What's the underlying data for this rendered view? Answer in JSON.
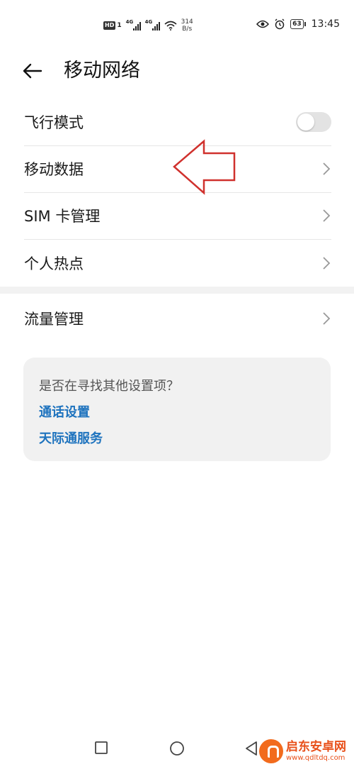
{
  "status_bar": {
    "hd_badge": "HD",
    "sim_index": "1",
    "signal1_label": "4G",
    "signal2_label": "4G",
    "speed_value": "314",
    "speed_unit": "B/s",
    "battery": "63",
    "time": "13:45"
  },
  "header": {
    "title": "移动网络"
  },
  "settings": {
    "airplane_mode": {
      "label": "飞行模式",
      "enabled": false
    },
    "mobile_data": {
      "label": "移动数据"
    },
    "sim_management": {
      "label": "SIM 卡管理"
    },
    "hotspot": {
      "label": "个人热点"
    },
    "data_usage": {
      "label": "流量管理"
    }
  },
  "suggestion_card": {
    "question": "是否在寻找其他设置项？",
    "links": [
      "通话设置",
      "天际通服务"
    ]
  },
  "watermark": {
    "title": "启东安卓网",
    "url": "www.qdltdq.com"
  },
  "colors": {
    "link": "#1e73be",
    "annotation_arrow": "#d0312d",
    "toggle_off": "#e3e3e3"
  },
  "icons": {
    "back": "arrow-left-icon",
    "chevron": "chevron-right-icon",
    "nav": [
      "square-icon",
      "circle-icon",
      "triangle-back-icon"
    ]
  }
}
